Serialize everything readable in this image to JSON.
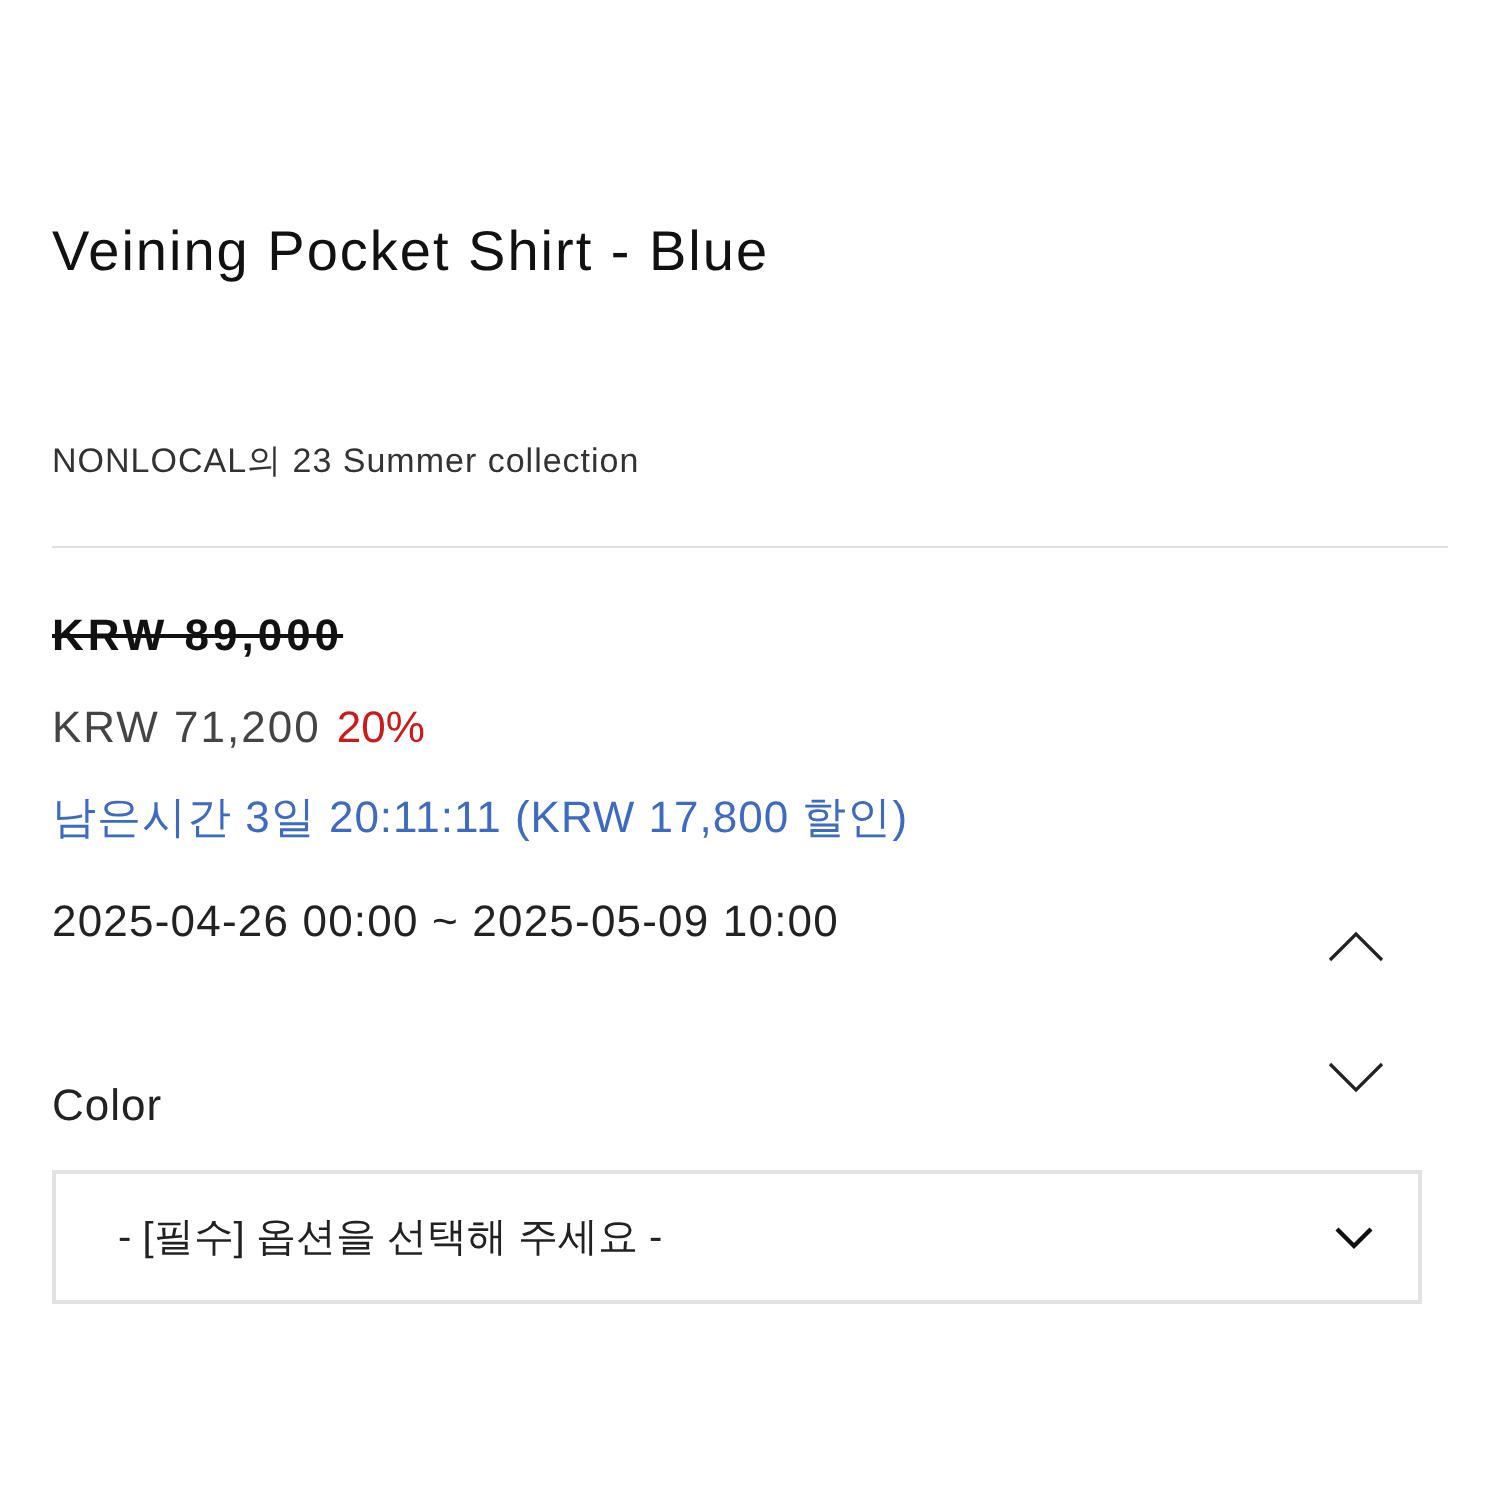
{
  "product": {
    "title": "Veining Pocket Shirt - Blue",
    "subtitle": "NONLOCAL의 23 Summer collection"
  },
  "price": {
    "original": "KRW 89,000",
    "sale": "KRW 71,200",
    "discount": "20%",
    "countdown": "남은시간 3일 20:11:11 (KRW 17,800 할인)",
    "period": "2025-04-26 00:00 ~ 2025-05-09 10:00"
  },
  "scroll_buttons": [
    {
      "kind": "up"
    },
    {
      "kind": "down"
    }
  ],
  "options": [
    {
      "label": "Color",
      "placeholder": "- [필수] 옵션을 선택해 주세요 -"
    }
  ]
}
